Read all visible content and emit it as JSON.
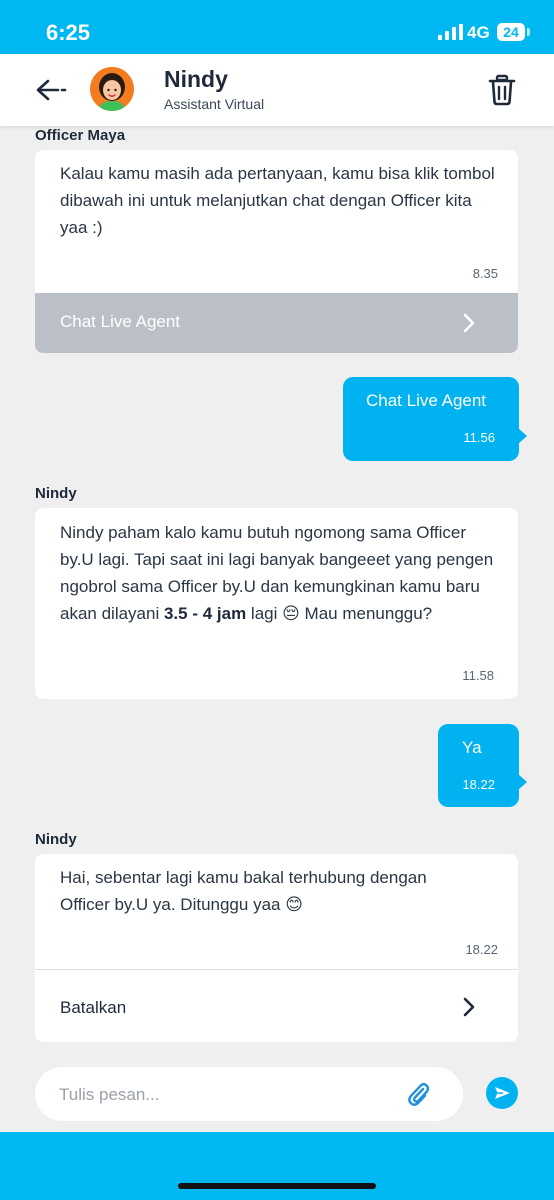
{
  "status_bar": {
    "time": "6:25",
    "network": "4G",
    "battery": "24"
  },
  "header": {
    "name": "Nindy",
    "subtitle": "Assistant Virtual"
  },
  "messages": [
    {
      "sender": "Officer Maya",
      "text": "Kalau kamu masih ada pertanyaan, kamu bisa klik tombol dibawah ini untuk melanjutkan chat dengan Officer kita yaa :)",
      "time": "8.35",
      "action": "Chat Live Agent"
    },
    {
      "outgoing": true,
      "text": "Chat Live Agent",
      "time": "11.56"
    },
    {
      "sender": "Nindy",
      "text_before": "Nindy paham kalo kamu butuh ngomong sama Officer by.U lagi. Tapi saat ini lagi banyak bangeeet yang pengen ngobrol sama Officer by.U dan kemungkinan kamu baru akan dilayani ",
      "text_bold": "3.5 - 4 jam",
      "text_after": " lagi 😔 Mau menunggu?",
      "time": "11.58"
    },
    {
      "outgoing": true,
      "text": "Ya",
      "time": "18.22"
    },
    {
      "sender": "Nindy",
      "text": "Hai, sebentar lagi kamu bakal terhubung dengan Officer by.U ya. Ditunggu yaa 😊",
      "time": "18.22",
      "action": "Batalkan"
    }
  ],
  "composer": {
    "placeholder": "Tulis pesan..."
  },
  "colors": {
    "brand": "#00b8f1",
    "bubble_out": "#00b2ef",
    "disabled_action": "#bbc0c8"
  },
  "icons": [
    "back-arrow-icon",
    "trash-icon",
    "chevron-right-icon",
    "paperclip-icon",
    "send-icon",
    "signal-icon"
  ]
}
